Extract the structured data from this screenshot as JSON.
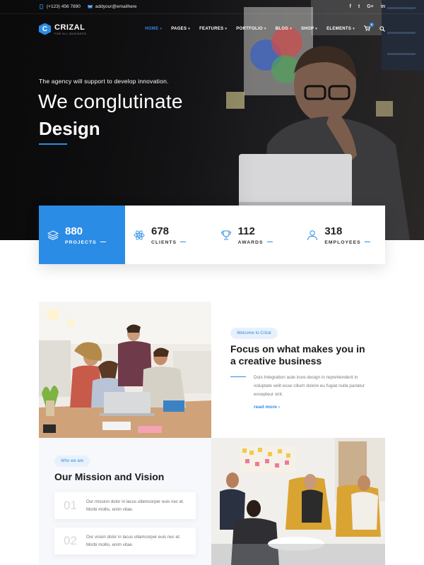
{
  "colors": {
    "accent": "#2b8ce6",
    "hero_bg": "#141416",
    "text_dark": "#1a1a1a",
    "muted": "#7a7a7a"
  },
  "topbar": {
    "phone": "(+123) 456 7890",
    "email": "addyour@emailhere",
    "phone_icon": "phone-icon",
    "email_icon": "mail-icon",
    "social": [
      "f",
      "t",
      "G+",
      "in"
    ]
  },
  "brand": {
    "name": "CRIZAL",
    "tagline": "FOR ALL BUSINESS"
  },
  "nav": {
    "items": [
      {
        "label": "HOME",
        "active": true
      },
      {
        "label": "PAGES"
      },
      {
        "label": "FEATURES"
      },
      {
        "label": "PORTFOLIO"
      },
      {
        "label": "BLOG"
      },
      {
        "label": "SHOP"
      },
      {
        "label": "ELEMENTS"
      }
    ],
    "cart_count": "0"
  },
  "hero": {
    "kicker": "The agency will support to develop innovation.",
    "line1": "We conglutinate",
    "line2": "Design"
  },
  "stats": [
    {
      "number": "880",
      "label": "PROJECTS",
      "icon": "layers-icon"
    },
    {
      "number": "678",
      "label": "CLIENTS",
      "icon": "atom-icon"
    },
    {
      "number": "112",
      "label": "AWARDS",
      "icon": "trophy-icon"
    },
    {
      "number": "318",
      "label": "EMPLOYEES",
      "icon": "user-icon"
    }
  ],
  "feature": {
    "badge": "Welcome to Crizal",
    "title": "Focus on what makes you in a creative business",
    "text": "Duis Integration aute irure design in reprehenderit in voluptate velit esse cillum dolore eu fugiat nulla pariatur excepteur sint.",
    "link": "read more"
  },
  "mission": {
    "badge": "Who we are",
    "title": "Our Mission and Vision",
    "cards": [
      {
        "num": "01",
        "text": "Our mission dolor in lacus ullamcorper euis nec et. Morbi mollis, enim vitae."
      },
      {
        "num": "02",
        "text": "Our vision dolor in lacus ullamcorper euis nec et. Morbi mollis, enim vitae."
      }
    ]
  }
}
